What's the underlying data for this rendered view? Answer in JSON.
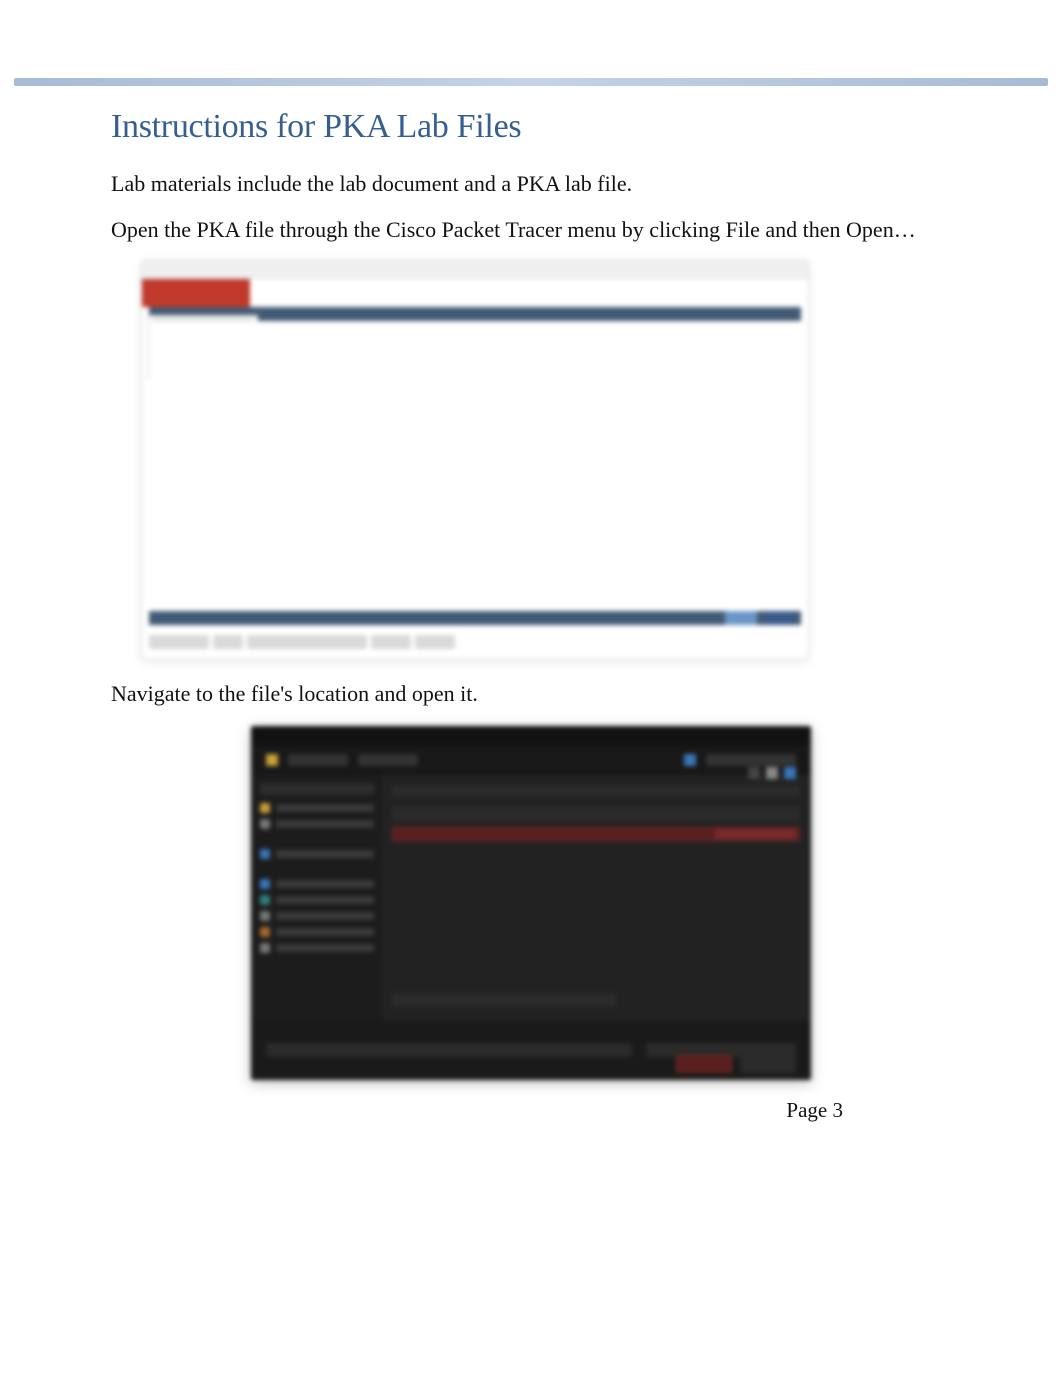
{
  "header": {
    "title": "Instructions for PKA Lab Files"
  },
  "paragraphs": {
    "p1": "Lab materials include the lab document and a PKA lab file.",
    "p2_a": "Open the PKA file through the Cisco Packet Tracer menu by clicking",
    "p2_b": "File",
    "p2_c": "and then Open…",
    "p3": "Navigate to the file's location and open it."
  },
  "footer": {
    "page_label": "Page 3"
  }
}
